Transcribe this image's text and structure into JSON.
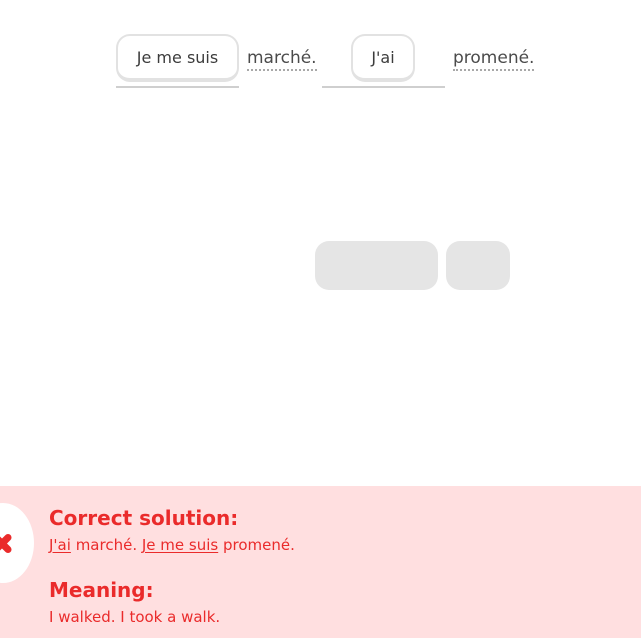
{
  "exercise": {
    "slot_1_chip": "Je me suis",
    "word_1": "marché.",
    "slot_2_chip": "J'ai",
    "word_2": "promené."
  },
  "feedback": {
    "correct_heading": "Correct solution:",
    "solution_part_1": "J'ai",
    "solution_part_2": " marché. ",
    "solution_part_3": "Je me suis",
    "solution_part_4": " promené.",
    "meaning_heading": "Meaning:",
    "meaning_text": "I walked. I took a walk.",
    "status_icon": "x-icon",
    "colors": {
      "panel_bg": "#ffdfe0",
      "accent": "#ea2b2b"
    }
  }
}
